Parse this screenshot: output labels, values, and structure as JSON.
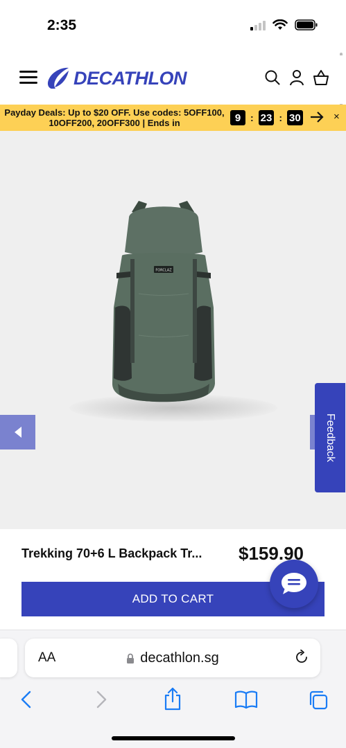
{
  "status_bar": {
    "time": "2:35",
    "icons": [
      "cellular-signal-icon",
      "wifi-icon",
      "battery-icon"
    ]
  },
  "header": {
    "logo_text": "DECATHLON",
    "icons": [
      "menu-icon",
      "search-icon",
      "account-icon",
      "cart-basket-icon"
    ],
    "brand_color": "#3643ba"
  },
  "promo": {
    "text": "Payday Deals: Up to $20 OFF. Use codes: 5OFF100, 10OFF200, 20OFF300 | Ends in",
    "timer": {
      "hours": "9",
      "minutes": "23",
      "seconds": "30"
    },
    "separator": ":",
    "arrow": "→",
    "close": "×",
    "background_color": "#fdd055"
  },
  "product": {
    "image_brand_label": "FORCLAZ",
    "title": "Trekking 70+6 L Backpack Tr...",
    "price": "$159.90",
    "add_to_cart_label": "ADD TO CART"
  },
  "carousel": {
    "prev_icon": "chevron-left-icon"
  },
  "feedback": {
    "label": "Feedback"
  },
  "chat": {
    "icon": "chat-bubble-icon"
  },
  "browser": {
    "aa_label": "AA",
    "url": "decathlon.sg",
    "toolbar_icons": [
      "back-icon",
      "forward-icon",
      "share-icon",
      "bookmarks-icon",
      "tabs-icon"
    ]
  }
}
